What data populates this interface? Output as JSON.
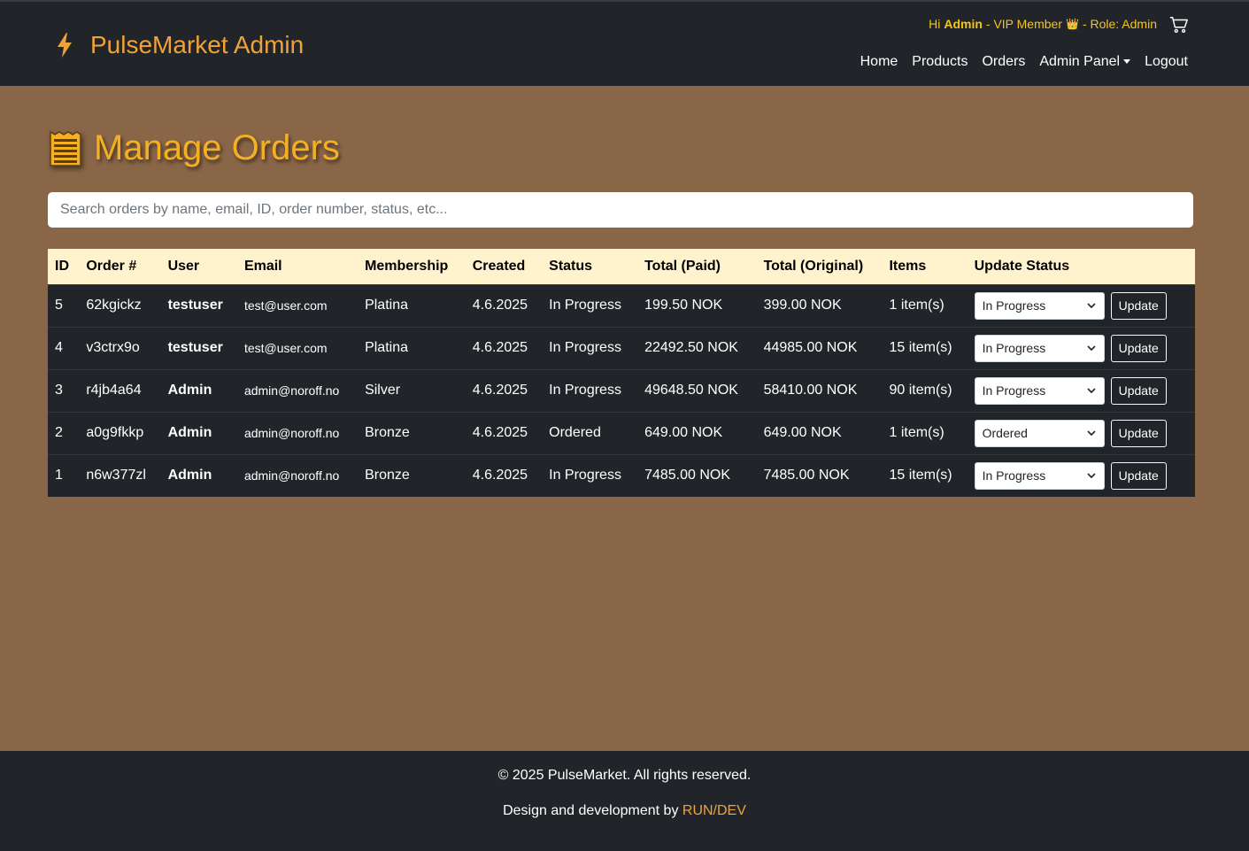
{
  "header": {
    "brand": "PulseMarket Admin",
    "greeting_prefix": "Hi ",
    "greeting_name": "Admin",
    "membership": " - VIP Member",
    "role": "- Role: Admin",
    "icons": {
      "brand": "bolt-icon",
      "cart": "cart-icon",
      "crown": "crown-icon"
    },
    "nav": {
      "home": "Home",
      "products": "Products",
      "orders": "Orders",
      "admin_panel": "Admin Panel",
      "logout": "Logout"
    }
  },
  "page": {
    "title": "Manage Orders",
    "title_icon": "receipt-icon",
    "search_placeholder": "Search orders by name, email, ID, order number, status, etc..."
  },
  "table": {
    "headers": [
      "ID",
      "Order #",
      "User",
      "Email",
      "Membership",
      "Created",
      "Status",
      "Total (Paid)",
      "Total (Original)",
      "Items",
      "Update Status"
    ],
    "update_label": "Update",
    "rows": [
      {
        "id": "5",
        "order": "62kgickz",
        "user": "testuser",
        "email": "test@user.com",
        "membership": "Platina",
        "created": "4.6.2025",
        "status": "In Progress",
        "paid": "199.50 NOK",
        "original": "399.00 NOK",
        "items": "1 item(s)",
        "select": "In Progress"
      },
      {
        "id": "4",
        "order": "v3ctrx9o",
        "user": "testuser",
        "email": "test@user.com",
        "membership": "Platina",
        "created": "4.6.2025",
        "status": "In Progress",
        "paid": "22492.50 NOK",
        "original": "44985.00 NOK",
        "items": "15 item(s)",
        "select": "In Progress"
      },
      {
        "id": "3",
        "order": "r4jb4a64",
        "user": "Admin",
        "email": "admin@noroff.no",
        "membership": "Silver",
        "created": "4.6.2025",
        "status": "In Progress",
        "paid": "49648.50 NOK",
        "original": "58410.00 NOK",
        "items": "90 item(s)",
        "select": "In Progress"
      },
      {
        "id": "2",
        "order": "a0g9fkkp",
        "user": "Admin",
        "email": "admin@noroff.no",
        "membership": "Bronze",
        "created": "4.6.2025",
        "status": "Ordered",
        "paid": "649.00 NOK",
        "original": "649.00 NOK",
        "items": "1 item(s)",
        "select": "Ordered"
      },
      {
        "id": "1",
        "order": "n6w377zl",
        "user": "Admin",
        "email": "admin@noroff.no",
        "membership": "Bronze",
        "created": "4.6.2025",
        "status": "In Progress",
        "paid": "7485.00 NOK",
        "original": "7485.00 NOK",
        "items": "15 item(s)",
        "select": "In Progress"
      }
    ]
  },
  "footer": {
    "copyright": "© 2025 PulseMarket. All rights reserved.",
    "credit_prefix": "Design and development by ",
    "credit_link": "RUN/DEV"
  },
  "colors": {
    "background": "#8a6648",
    "header_bg": "#212529",
    "accent": "#f0a23a",
    "title": "#f5b022",
    "table_header_bg": "#fff3cd"
  }
}
